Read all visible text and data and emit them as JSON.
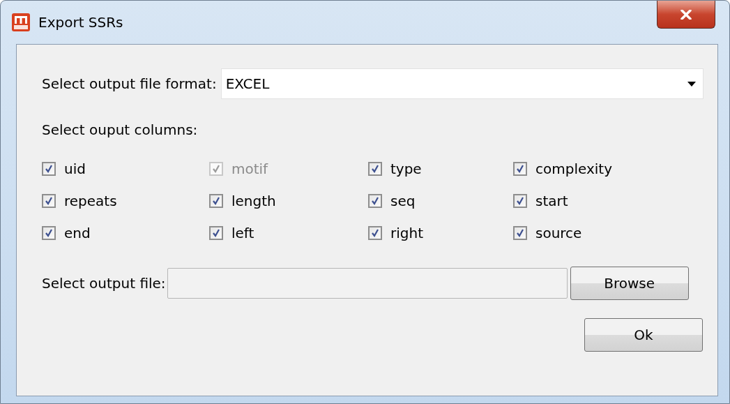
{
  "window": {
    "title": "Export SSRs"
  },
  "format": {
    "label": "Select output file format:",
    "value": "EXCEL"
  },
  "columns_label": "Select ouput columns:",
  "columns": [
    {
      "label": "uid",
      "checked": true,
      "disabled": false
    },
    {
      "label": "motif",
      "checked": true,
      "disabled": true
    },
    {
      "label": "type",
      "checked": true,
      "disabled": false
    },
    {
      "label": "complexity",
      "checked": true,
      "disabled": false
    },
    {
      "label": "repeats",
      "checked": true,
      "disabled": false
    },
    {
      "label": "length",
      "checked": true,
      "disabled": false
    },
    {
      "label": "seq",
      "checked": true,
      "disabled": false
    },
    {
      "label": "start",
      "checked": true,
      "disabled": false
    },
    {
      "label": "end",
      "checked": true,
      "disabled": false
    },
    {
      "label": "left",
      "checked": true,
      "disabled": false
    },
    {
      "label": "right",
      "checked": true,
      "disabled": false
    },
    {
      "label": "source",
      "checked": true,
      "disabled": false
    }
  ],
  "output": {
    "label": "Select output file:",
    "button": "Browse"
  },
  "buttons": [
    "Ok"
  ]
}
